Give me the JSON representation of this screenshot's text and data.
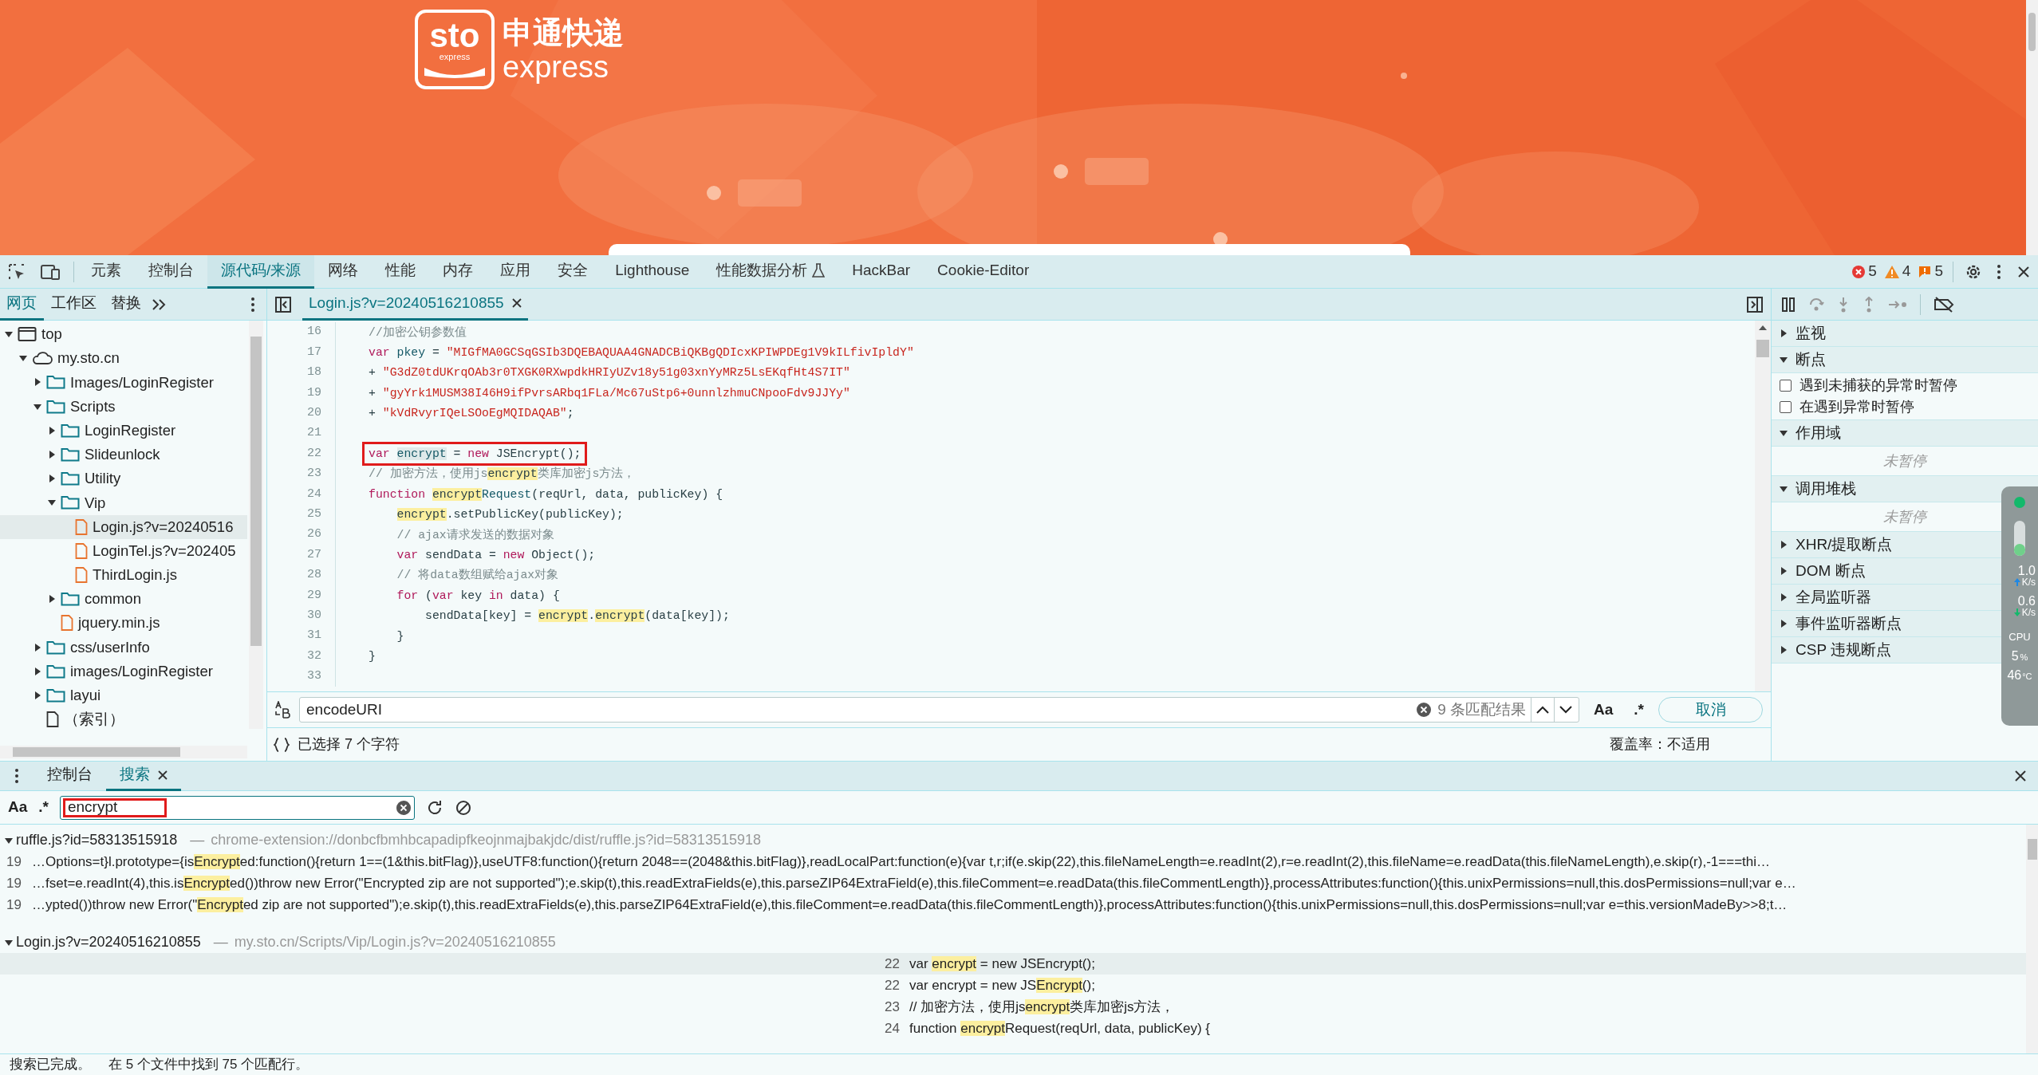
{
  "banner": {
    "logo_mark": "sto",
    "logo_mark_sub": "express",
    "logo_cn": "申通快递",
    "logo_en": "express"
  },
  "toolbar": {
    "tabs": [
      {
        "label": "元素",
        "selected": false
      },
      {
        "label": "控制台",
        "selected": false
      },
      {
        "label": "源代码/来源",
        "selected": true
      },
      {
        "label": "网络",
        "selected": false
      },
      {
        "label": "性能",
        "selected": false
      },
      {
        "label": "内存",
        "selected": false
      },
      {
        "label": "应用",
        "selected": false
      },
      {
        "label": "安全",
        "selected": false
      },
      {
        "label": "Lighthouse",
        "selected": false
      },
      {
        "label": "性能数据分析",
        "selected": false,
        "experimental": true
      },
      {
        "label": "HackBar",
        "selected": false
      },
      {
        "label": "Cookie-Editor",
        "selected": false
      }
    ],
    "errors": "5",
    "warnings": "4",
    "issues": "5"
  },
  "navigator": {
    "tabs": [
      {
        "label": "网页",
        "selected": true
      },
      {
        "label": "工作区",
        "selected": false
      },
      {
        "label": "替换",
        "selected": false
      }
    ],
    "tree": [
      {
        "label": "top",
        "kind": "frame",
        "expanded": true,
        "selected": false,
        "children": [
          {
            "label": "my.sto.cn",
            "kind": "domain",
            "expanded": true,
            "selected": false,
            "children": [
              {
                "label": "Images/LoginRegister",
                "kind": "folder",
                "expanded": false,
                "selected": false
              },
              {
                "label": "Scripts",
                "kind": "folder",
                "expanded": true,
                "selected": false,
                "children": [
                  {
                    "label": "LoginRegister",
                    "kind": "folder",
                    "expanded": false,
                    "selected": false
                  },
                  {
                    "label": "Slideunlock",
                    "kind": "folder",
                    "expanded": false,
                    "selected": false
                  },
                  {
                    "label": "Utility",
                    "kind": "folder",
                    "expanded": false,
                    "selected": false
                  },
                  {
                    "label": "Vip",
                    "kind": "folder",
                    "expanded": true,
                    "selected": false,
                    "children": [
                      {
                        "label": "Login.js?v=20240516",
                        "kind": "script",
                        "selected": true
                      },
                      {
                        "label": "LoginTel.js?v=202405",
                        "kind": "script",
                        "selected": false
                      },
                      {
                        "label": "ThirdLogin.js",
                        "kind": "script",
                        "selected": false
                      }
                    ]
                  },
                  {
                    "label": "common",
                    "kind": "folder",
                    "expanded": false,
                    "selected": false
                  },
                  {
                    "label": "jquery.min.js",
                    "kind": "script",
                    "selected": false
                  }
                ]
              },
              {
                "label": "css/userInfo",
                "kind": "folder",
                "expanded": false,
                "selected": false
              },
              {
                "label": "images/LoginRegister",
                "kind": "folder",
                "expanded": false,
                "selected": false
              },
              {
                "label": "layui",
                "kind": "folder",
                "expanded": false,
                "selected": false
              },
              {
                "label": "（索引）",
                "kind": "document",
                "selected": false
              }
            ]
          }
        ]
      }
    ]
  },
  "editor": {
    "tab": "Login.js?v=20240516210855",
    "lines": [
      {
        "number": "16",
        "kind": "top",
        "tokens": [
          {
            "t": "//加密公钥参数值",
            "kind": "comment"
          }
        ]
      },
      {
        "number": "17",
        "kind": "top",
        "tokens": [
          {
            "t": "var ",
            "kind": "keyword"
          },
          {
            "t": "pkey",
            "kind": "ident"
          },
          {
            "t": " = ",
            "kind": "plain"
          },
          {
            "t": "\"MIGfMA0GCSqGSIb3DQEBAQUAA4GNADCBiQKBgQDIcxKPIWPDEg1V9kILfivIpldY\"",
            "kind": "string"
          }
        ]
      },
      {
        "number": "18",
        "kind": "top",
        "tokens": [
          {
            "t": "+ ",
            "kind": "plain"
          },
          {
            "t": "\"G3dZ0tdUKrqOAb3r0TXGK0RXwpdkHRIyUZv18y51g03xnYyMRz5LsEKqfHt4S7IT\"",
            "kind": "string"
          }
        ]
      },
      {
        "number": "19",
        "kind": "top",
        "tokens": [
          {
            "t": "+ ",
            "kind": "plain"
          },
          {
            "t": "\"gyYrk1MUSM38I46H9ifPvrsARbq1FLa/Mc67uStp6+0unnlzhmuCNpooFdv9JJYy\"",
            "kind": "string"
          }
        ]
      },
      {
        "number": "20",
        "kind": "top",
        "tokens": [
          {
            "t": "+ ",
            "kind": "plain"
          },
          {
            "t": "\"kVdRvyrIQeLSOoEgMQIDAQAB\"",
            "kind": "string"
          },
          {
            "t": ";",
            "kind": "plain"
          }
        ]
      },
      {
        "number": "21"
      },
      {
        "number": "22",
        "kind": "top",
        "annotated": true,
        "tokens": [
          {
            "t": "var ",
            "kind": "keyword"
          },
          {
            "t": "encrypt",
            "kind": "selection"
          },
          {
            "t": " = ",
            "kind": "plain"
          },
          {
            "t": "new",
            "kind": "keyword"
          },
          {
            "t": " JSEncrypt();",
            "kind": "plain"
          }
        ]
      },
      {
        "number": "23",
        "kind": "top",
        "tokens": [
          {
            "t": "// 加密方法，使用js",
            "kind": "comment"
          },
          {
            "t": "encrypt",
            "kind": "match"
          },
          {
            "t": "类库加密js方法，",
            "kind": "comment"
          }
        ]
      },
      {
        "number": "24",
        "kind": "top",
        "tokens": [
          {
            "t": "function ",
            "kind": "keyword"
          },
          {
            "t": "encrypt",
            "kind": "match"
          },
          {
            "t": "Request",
            "kind": "ident"
          },
          {
            "t": "(reqUrl, data, publicKey) {",
            "kind": "plain"
          }
        ]
      },
      {
        "number": "25",
        "kind": "body",
        "tokens": [
          {
            "t": "encrypt",
            "kind": "match"
          },
          {
            "t": ".setPublicKey(publicKey);",
            "kind": "plain"
          }
        ]
      },
      {
        "number": "26",
        "kind": "body",
        "tokens": [
          {
            "t": "// ajax请求发送的数据对象",
            "kind": "comment"
          }
        ]
      },
      {
        "number": "27",
        "kind": "body",
        "tokens": [
          {
            "t": "var",
            "kind": "keyword"
          },
          {
            "t": " sendData = ",
            "kind": "plain"
          },
          {
            "t": "new",
            "kind": "keyword"
          },
          {
            "t": " Object();",
            "kind": "plain"
          }
        ]
      },
      {
        "number": "28",
        "kind": "body",
        "tokens": [
          {
            "t": "// 将data数组赋给ajax对象",
            "kind": "comment"
          }
        ]
      },
      {
        "number": "29",
        "kind": "body",
        "tokens": [
          {
            "t": "for",
            "kind": "keyword"
          },
          {
            "t": " (",
            "kind": "plain"
          },
          {
            "t": "var",
            "kind": "keyword"
          },
          {
            "t": " key ",
            "kind": "plain"
          },
          {
            "t": "in",
            "kind": "keyword"
          },
          {
            "t": " data) {",
            "kind": "plain"
          }
        ]
      },
      {
        "number": "30",
        "kind": "nested",
        "tokens": [
          {
            "t": "sendData[key] = ",
            "kind": "plain"
          },
          {
            "t": "encrypt",
            "kind": "match"
          },
          {
            "t": ".",
            "kind": "plain"
          },
          {
            "t": "encrypt",
            "kind": "match"
          },
          {
            "t": "(data[key]);",
            "kind": "plain"
          }
        ]
      },
      {
        "number": "31",
        "kind": "body",
        "tokens": [
          {
            "t": "}",
            "kind": "plain"
          }
        ]
      },
      {
        "number": "32",
        "kind": "top",
        "tokens": [
          {
            "t": "}",
            "kind": "plain"
          }
        ]
      },
      {
        "number": "33"
      }
    ],
    "search": {
      "value": "encodeURI",
      "result_count": "9 条匹配结果",
      "case_label": "Aa",
      "regex_label": ".*",
      "cancel": "取消"
    },
    "status": {
      "selection": "已选择 7 个字符",
      "coverage": "覆盖率：不适用"
    }
  },
  "debugger": {
    "sections": [
      {
        "title": "监视",
        "expanded": false
      },
      {
        "title": "断点",
        "expanded": true,
        "items": [
          {
            "label": "遇到未捕获的异常时暂停",
            "checked": false
          },
          {
            "label": "在遇到异常时暂停",
            "checked": false
          }
        ]
      },
      {
        "title": "作用域",
        "expanded": true,
        "note": "未暂停"
      },
      {
        "title": "调用堆栈",
        "expanded": true,
        "note": "未暂停"
      },
      {
        "title": "XHR/提取断点",
        "expanded": false
      },
      {
        "title": "DOM 断点",
        "expanded": false
      },
      {
        "title": "全局监听器",
        "expanded": false
      },
      {
        "title": "事件监听器断点",
        "expanded": false
      },
      {
        "title": "CSP 违规断点",
        "expanded": false
      }
    ]
  },
  "monitor": {
    "upload": "1.0",
    "upload_unit": "K/s",
    "download": "0.6",
    "download_unit": "K/s",
    "cpu_label": "CPU",
    "cpu": "5",
    "cpu_unit": "%",
    "temp": "46",
    "temp_unit": "°C"
  },
  "drawer": {
    "tabs": [
      {
        "label": "控制台",
        "selected": false,
        "closable": false
      },
      {
        "label": "搜索",
        "selected": true,
        "closable": true
      }
    ],
    "search": {
      "case_label": "Aa",
      "regex_label": ".*",
      "query": "encrypt",
      "annotated": true
    },
    "results": [
      {
        "file": "ruffle.js?id=58313515918",
        "separator": "—",
        "url": "chrome-extension://donbcfbmhbcapadipfkeojnmajbakjdc/dist/ruffle.js?id=58313515918",
        "expanded": true,
        "centered": false,
        "matches": [
          {
            "line": "19",
            "selected": false,
            "parts": [
              {
                "t": "…Options=t}l.prototype={is",
                "match": false
              },
              {
                "t": "Encrypt",
                "match": true
              },
              {
                "t": "ed:function(){return 1==(1&this.bitFlag)},useUTF8:function(){return 2048==(2048&this.bitFlag)},readLocalPart:function(e){var t,r;if(e.skip(22),this.fileNameLength=e.readInt(2),r=e.readInt(2),this.fileName=e.readData(this.fileNameLength),e.skip(r),-1===thi…",
                "match": false
              }
            ]
          },
          {
            "line": "19",
            "selected": false,
            "parts": [
              {
                "t": "…fset=e.readInt(4),this.is",
                "match": false
              },
              {
                "t": "Encrypt",
                "match": true
              },
              {
                "t": "ed())throw new Error(\"Encrypted zip are not supported\");e.skip(t),this.readExtraFields(e),this.parseZIP64ExtraField(e),this.fileComment=e.readData(this.fileCommentLength)},processAttributes:function(){this.unixPermissions=null,this.dosPermissions=null;var e…",
                "match": false
              }
            ]
          },
          {
            "line": "19",
            "selected": false,
            "parts": [
              {
                "t": "…ypted())throw new Error(\"",
                "match": false
              },
              {
                "t": "Encrypt",
                "match": true
              },
              {
                "t": "ed zip are not supported\");e.skip(t),this.readExtraFields(e),this.parseZIP64ExtraField(e),this.fileComment=e.readData(this.fileCommentLength)},processAttributes:function(){this.unixPermissions=null,this.dosPermissions=null;var e=this.versionMadeBy>>8;t…",
                "match": false
              }
            ]
          }
        ]
      },
      {
        "file": "Login.js?v=20240516210855",
        "separator": "—",
        "url": "my.sto.cn/Scripts/Vip/Login.js?v=20240516210855",
        "expanded": true,
        "centered": true,
        "matches": [
          {
            "line": "22",
            "selected": true,
            "parts": [
              {
                "t": "var ",
                "match": false
              },
              {
                "t": "encrypt",
                "match": true
              },
              {
                "t": " = new JSEncrypt();",
                "match": false
              }
            ]
          },
          {
            "line": "22",
            "selected": false,
            "parts": [
              {
                "t": "var encrypt = new JS",
                "match": false
              },
              {
                "t": "Encrypt",
                "match": true
              },
              {
                "t": "();",
                "match": false
              }
            ]
          },
          {
            "line": "23",
            "selected": false,
            "parts": [
              {
                "t": "// 加密方法，使用js",
                "match": false
              },
              {
                "t": "encrypt",
                "match": true
              },
              {
                "t": "类库加密js方法，",
                "match": false
              }
            ]
          },
          {
            "line": "24",
            "selected": false,
            "parts": [
              {
                "t": "function ",
                "match": false
              },
              {
                "t": "encrypt",
                "match": true
              },
              {
                "t": "Request(reqUrl, data, publicKey) {",
                "match": false
              }
            ]
          }
        ]
      }
    ],
    "status": {
      "done": "搜索已完成。",
      "summary": "在 5 个文件中找到 75 个匹配行。"
    }
  }
}
